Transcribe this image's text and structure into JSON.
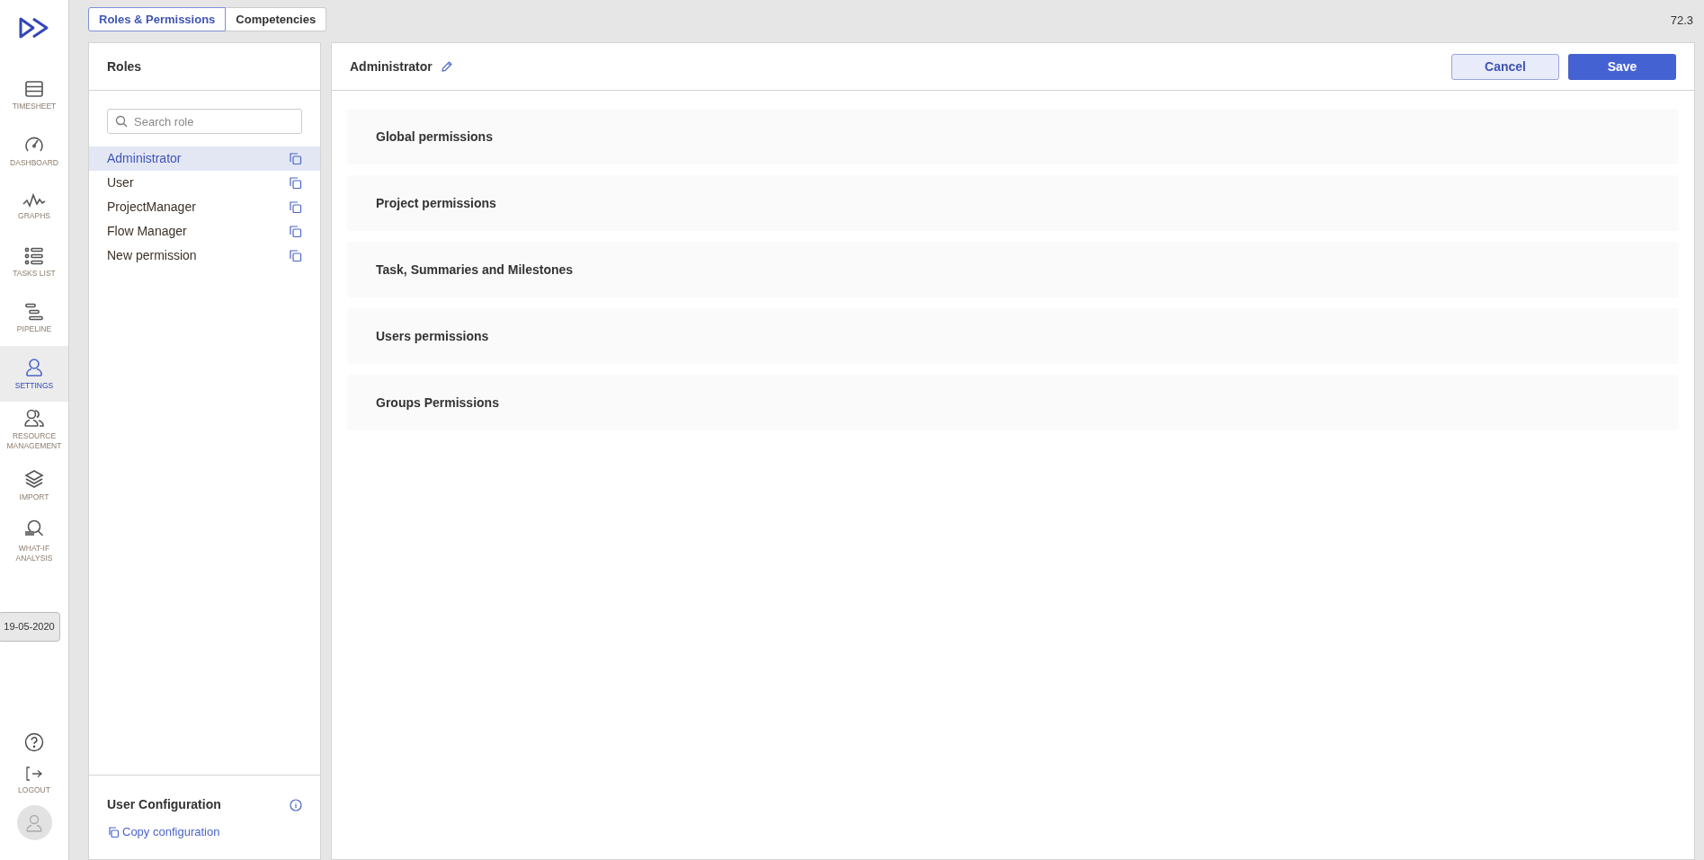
{
  "nav": {
    "items": [
      {
        "label": "TIMESHEET",
        "selected": false
      },
      {
        "label": "DASHBOARD",
        "selected": false
      },
      {
        "label": "GRAPHS",
        "selected": false
      },
      {
        "label": "TASKS LIST",
        "selected": false
      },
      {
        "label": "PIPELINE",
        "selected": false
      },
      {
        "label": "SETTINGS",
        "selected": true
      },
      {
        "label": "RESOURCE MANAGEMENT",
        "selected": false
      },
      {
        "label": "IMPORT",
        "selected": false
      },
      {
        "label": "WHAT-IF ANALYSIS",
        "selected": false
      }
    ],
    "date": "19-05-2020",
    "logout": "LOGOUT"
  },
  "tabs": [
    {
      "label": "Roles & Permissions",
      "selected": true
    },
    {
      "label": "Competencies",
      "selected": false
    }
  ],
  "version": "72.3",
  "roles": {
    "title": "Roles",
    "search": {
      "placeholder": "Search role"
    },
    "items": [
      {
        "label": "Administrator",
        "selected": true
      },
      {
        "label": "User",
        "selected": false
      },
      {
        "label": "ProjectManager",
        "selected": false
      },
      {
        "label": "Flow Manager",
        "selected": false
      },
      {
        "label": "New permission",
        "selected": false
      }
    ],
    "footer": {
      "title": "User Configuration",
      "link": "Copy configuration"
    }
  },
  "editor": {
    "title": "Administrator",
    "buttons": [
      "Cancel",
      "Save"
    ],
    "sections": [
      "Global permissions",
      "Project permissions",
      "Task, Summaries and Milestones",
      "Users permissions",
      "Groups Permissions"
    ]
  }
}
